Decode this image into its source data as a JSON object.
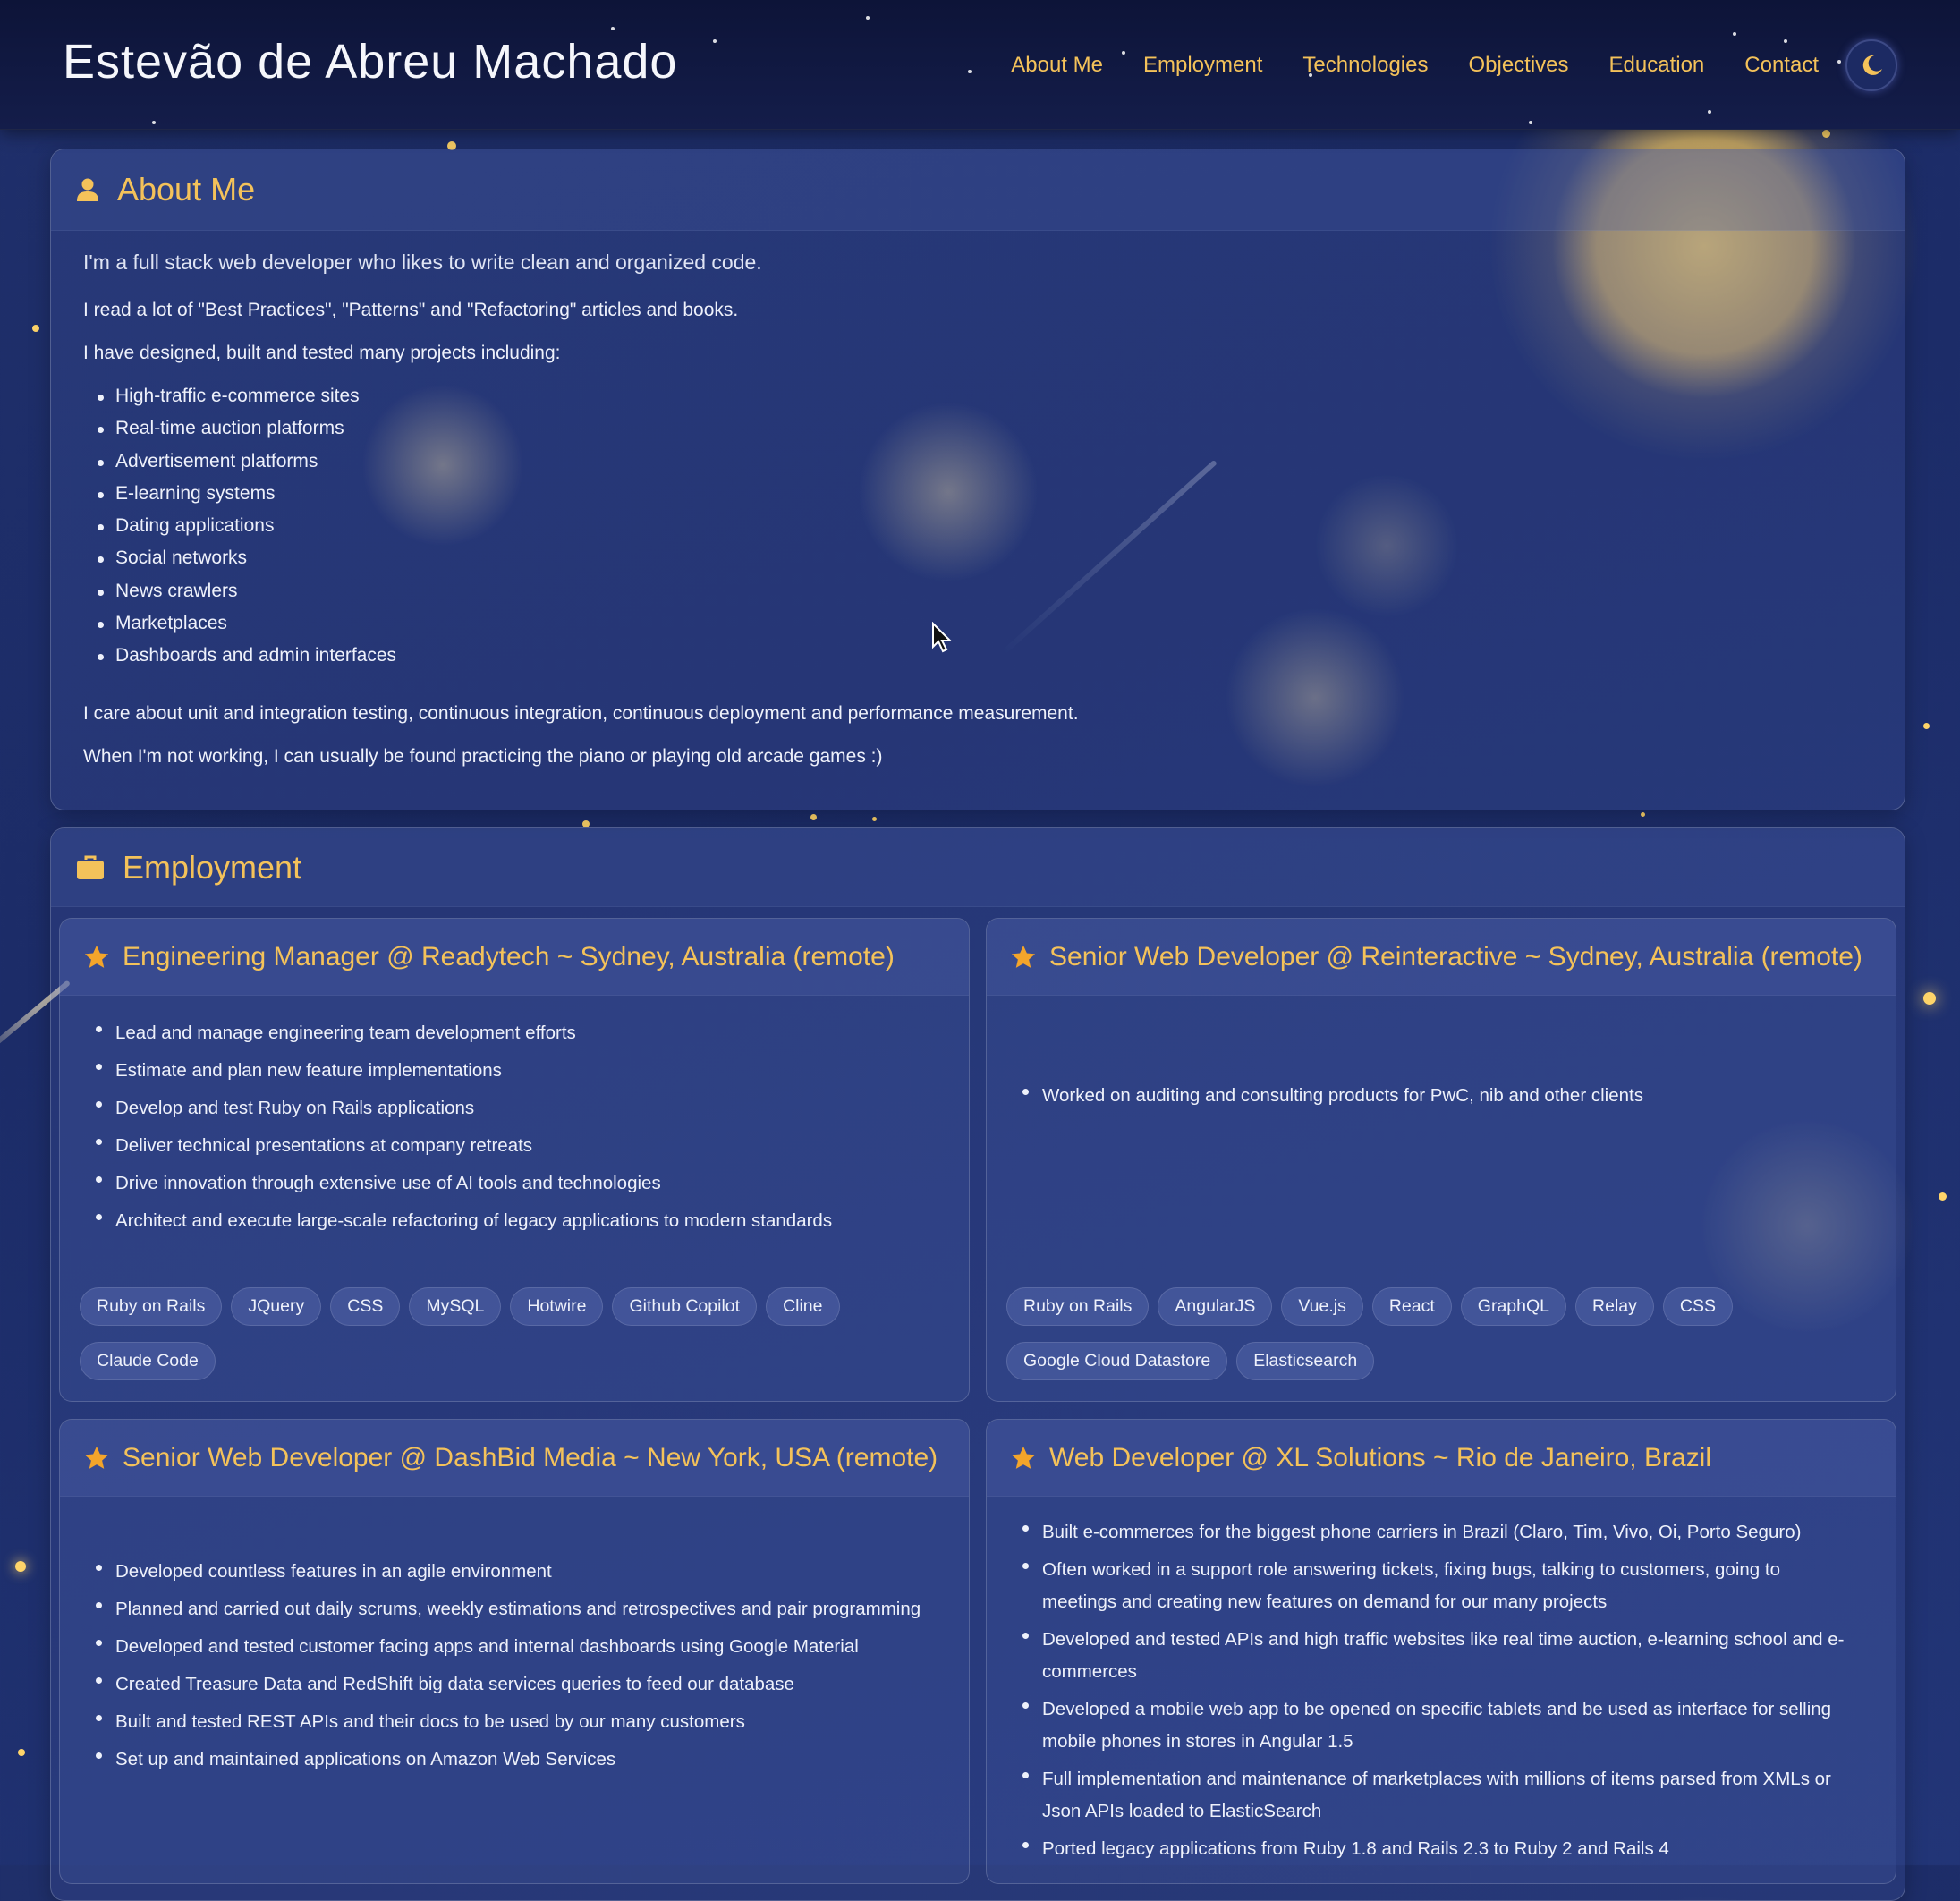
{
  "header": {
    "site_title": "Estevão de Abreu Machado",
    "nav": [
      "About Me",
      "Employment",
      "Technologies",
      "Objectives",
      "Education",
      "Contact"
    ],
    "theme_toggle_icon": "moon-icon"
  },
  "about": {
    "heading": "About Me",
    "icon": "user-icon",
    "lead": "I'm a full stack web developer who likes to write clean and organized code.",
    "para1": "I read a lot of \"Best Practices\", \"Patterns\" and \"Refactoring\" articles and books.",
    "para2": "I have designed, built and tested many projects including:",
    "projects": [
      "High-traffic e-commerce sites",
      "Real-time auction platforms",
      "Advertisement platforms",
      "E-learning systems",
      "Dating applications",
      "Social networks",
      "News crawlers",
      "Marketplaces",
      "Dashboards and admin interfaces"
    ],
    "para3": "I care about unit and integration testing, continuous integration, continuous deployment and performance measurement.",
    "para4": "When I'm not working, I can usually be found practicing the piano or playing old arcade games :)"
  },
  "employment": {
    "heading": "Employment",
    "icon": "briefcase-icon",
    "jobs": [
      {
        "title": "Engineering Manager @ Readytech ~ Sydney, Australia (remote)",
        "items": [
          "Lead and manage engineering team development efforts",
          "Estimate and plan new feature implementations",
          "Develop and test Ruby on Rails applications",
          "Deliver technical presentations at company retreats",
          "Drive innovation through extensive use of AI tools and technologies",
          "Architect and execute large-scale refactoring of legacy applications to modern standards"
        ],
        "tags": [
          "Ruby on Rails",
          "JQuery",
          "CSS",
          "MySQL",
          "Hotwire",
          "Github Copilot",
          "Cline",
          "Claude Code"
        ]
      },
      {
        "title": "Senior Web Developer @ Reinteractive ~ Sydney, Australia (remote)",
        "items": [
          "Worked on auditing and consulting products for PwC, nib and other clients"
        ],
        "tags": [
          "Ruby on Rails",
          "AngularJS",
          "Vue.js",
          "React",
          "GraphQL",
          "Relay",
          "CSS",
          "Google Cloud Datastore",
          "Elasticsearch"
        ]
      },
      {
        "title": "Senior Web Developer @ DashBid Media ~ New York, USA (remote)",
        "items": [
          "Developed countless features in an agile environment",
          "Planned and carried out daily scrums, weekly estimations and retrospectives and pair programming",
          "Developed and tested customer facing apps and internal dashboards using Google Material",
          "Created Treasure Data and RedShift big data services queries to feed our database",
          "Built and tested REST APIs and their docs to be used by our many customers",
          "Set up and maintained applications on Amazon Web Services"
        ]
      },
      {
        "title": "Web Developer @ XL Solutions ~ Rio de Janeiro, Brazil",
        "items": [
          "Built e-commerces for the biggest phone carriers in Brazil (Claro, Tim, Vivo, Oi, Porto Seguro)",
          "Often worked in a support role answering tickets, fixing bugs, talking to customers, going to meetings and creating new features on demand for our many projects",
          "Developed and tested APIs and high traffic websites like real time auction, e-learning school and e-commerces",
          "Developed a mobile web app to be opened on specific tablets and be used as interface for selling mobile phones in stores in Angular 1.5",
          "Full implementation and maintenance of marketplaces with millions of items parsed from XMLs or Json APIs loaded to ElasticSearch",
          "Ported legacy applications from Ruby 1.8 and Rails 2.3 to Ruby 2 and Rails 4"
        ]
      }
    ]
  },
  "colors": {
    "accent": "#f4c25a",
    "background": "#1f2f6a",
    "header": "#0d1438"
  }
}
